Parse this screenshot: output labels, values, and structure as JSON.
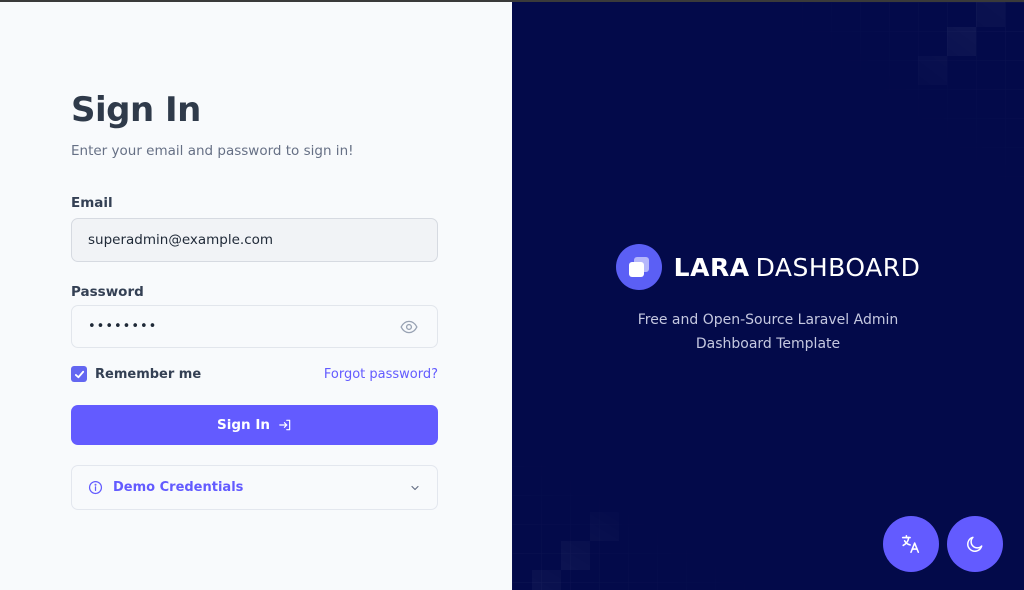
{
  "signin": {
    "title": "Sign In",
    "subtitle": "Enter your email and password to sign in!",
    "email_label": "Email",
    "email_value": "superadmin@example.com",
    "password_label": "Password",
    "password_value": "password",
    "remember_label": "Remember me",
    "remember_checked": true,
    "forgot_label": "Forgot password?",
    "button_label": "Sign In",
    "demo_label": "Demo Credentials"
  },
  "brand": {
    "name_bold": "LARA",
    "name_light": "DASHBOARD",
    "tagline_line1": "Free and Open-Source Laravel Admin",
    "tagline_line2": "Dashboard Template"
  },
  "colors": {
    "accent": "#635bff",
    "panel_dark": "#030a4a",
    "panel_light": "#f8fafc"
  },
  "icons": {
    "password_toggle": "eye-icon",
    "signin": "arrow-right-to-bracket-icon",
    "demo_info": "info-icon",
    "demo_expand": "chevron-down-icon",
    "language": "translate-icon",
    "theme": "moon-icon"
  }
}
